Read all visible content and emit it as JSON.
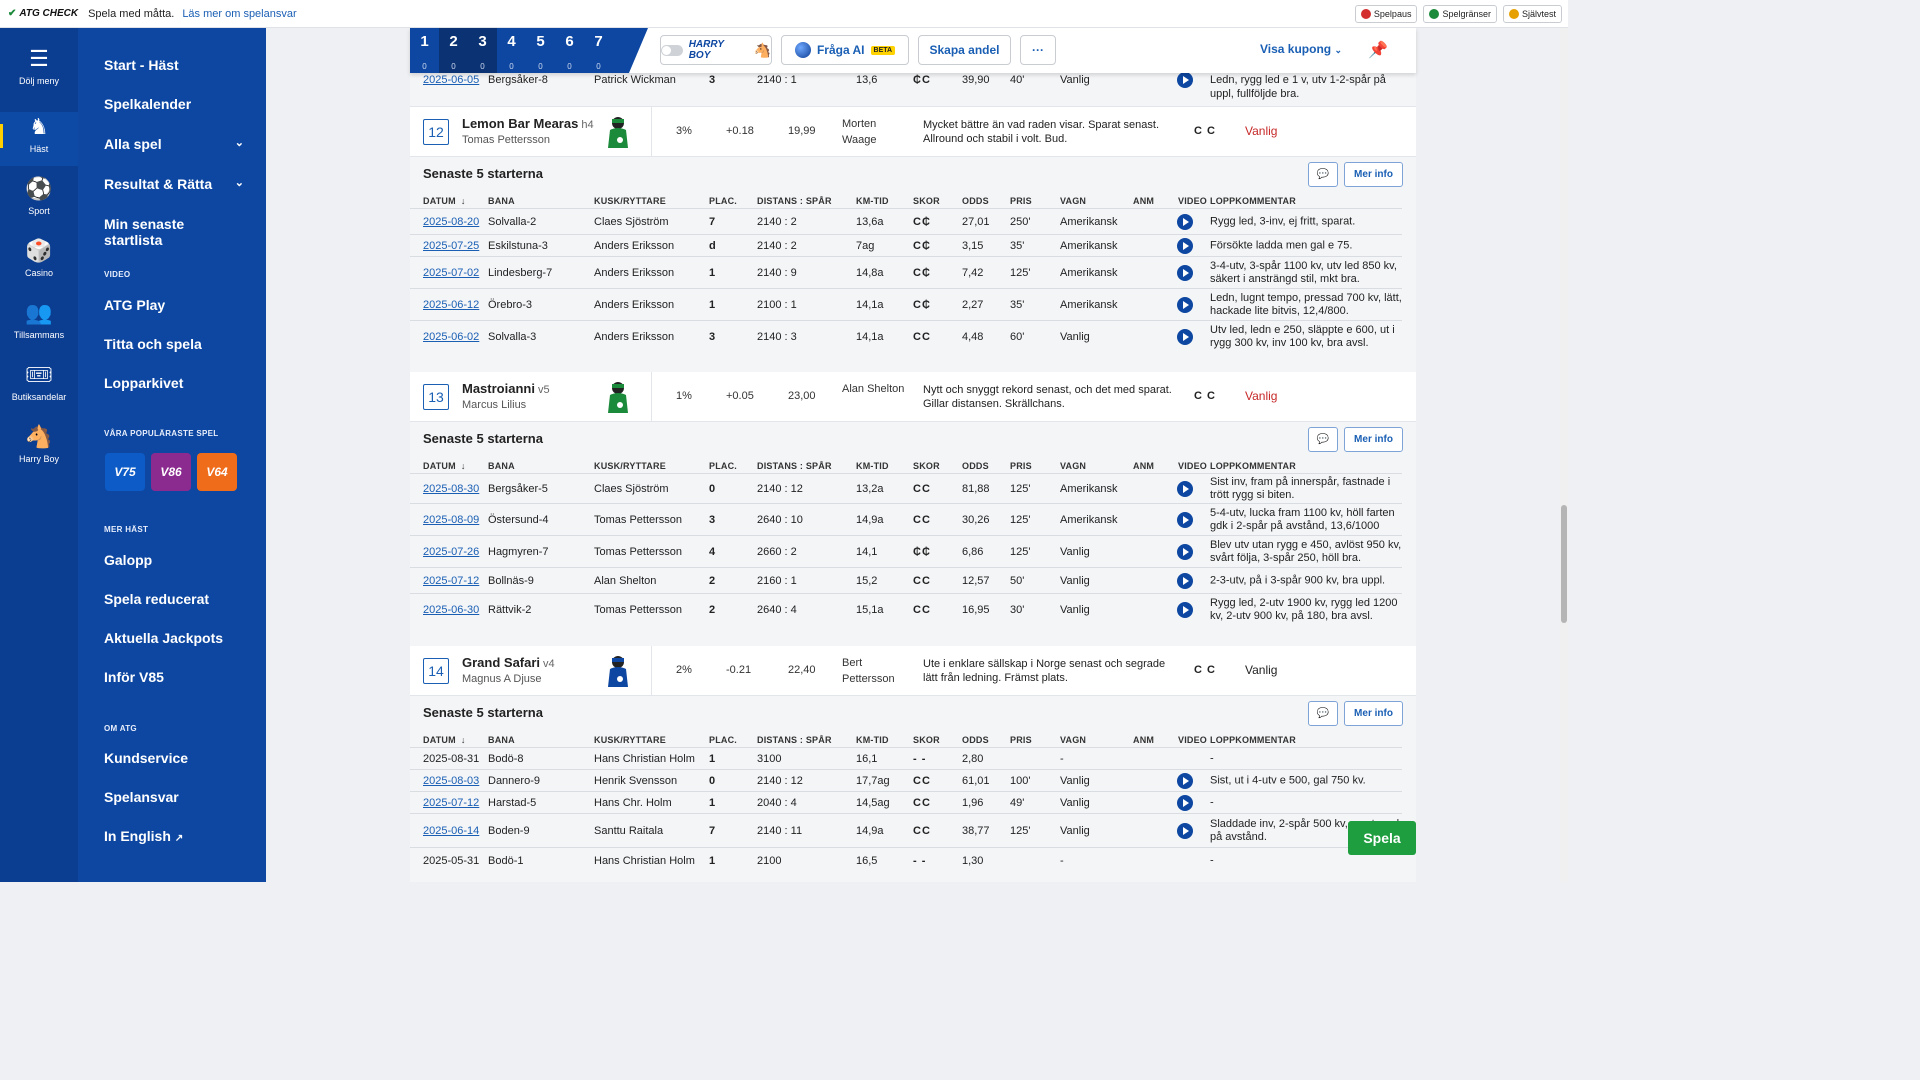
{
  "topbar": {
    "brand": "ATG CHECK",
    "message": "Spela med måtta.",
    "link": "Läs mer om spelansvar",
    "buttons": [
      {
        "label": "Spelpaus",
        "icon": "pause-icon",
        "color": "#d32f2f"
      },
      {
        "label": "Spelgränser",
        "icon": "limit-icon",
        "color": "#1b8a3a"
      },
      {
        "label": "Självtest",
        "icon": "selftest-icon",
        "color": "#e6a100"
      }
    ]
  },
  "rail": [
    {
      "label": "Dölj meny",
      "icon": "menu-icon"
    },
    {
      "label": "Häst",
      "icon": "horse-icon",
      "active": true
    },
    {
      "label": "Sport",
      "icon": "football-icon"
    },
    {
      "label": "Casino",
      "icon": "casino-icon"
    },
    {
      "label": "Tillsammans",
      "icon": "people-icon"
    },
    {
      "label": "Butiksandelar",
      "icon": "coupon-icon"
    },
    {
      "label": "Harry Boy",
      "icon": "harry-boy-icon"
    }
  ],
  "menu": {
    "items": [
      "Start - Häst",
      "Spelkalender",
      "Alla spel",
      "Resultat & Rätta",
      "Min senaste startlista"
    ],
    "video_heading": "VIDEO",
    "video_items": [
      "ATG Play",
      "Titta och spela",
      "Lopparkivet"
    ],
    "popular_heading": "VÅRA POPULÄRASTE SPEL",
    "games": [
      {
        "label": "V75",
        "color": "#0d5bc6"
      },
      {
        "label": "V86",
        "color": "#8b2a8f"
      },
      {
        "label": "V64",
        "color": "#ef6c1a"
      }
    ],
    "more_heading": "MER HÄST",
    "more_items": [
      "Galopp",
      "Spela reducerat",
      "Aktuella Jackpots",
      "Inför V85"
    ],
    "about_heading": "OM ATG",
    "about_items": [
      "Kundservice",
      "Spelansvar",
      "In English"
    ]
  },
  "toolbar": {
    "races": [
      {
        "num": "1",
        "count": "0"
      },
      {
        "num": "2",
        "count": "0",
        "selected": true
      },
      {
        "num": "3",
        "count": "0",
        "selected": true
      },
      {
        "num": "4",
        "count": "0"
      },
      {
        "num": "5",
        "count": "0"
      },
      {
        "num": "6",
        "count": "0"
      },
      {
        "num": "7",
        "count": "0"
      }
    ],
    "harry_boy": "HARRY BOY",
    "ai_label": "Fråga AI",
    "beta": "BETA",
    "andel": "Skapa andel",
    "more": "···",
    "kupong": "Visa kupong"
  },
  "partial_row": [
    "2025-06-05",
    "Bergsåker-8",
    "Patrick Wickman",
    "3",
    "2140 : 1",
    "13,6",
    "₵C",
    "39,90",
    "40'",
    "Vanlig",
    "Ledn, rygg led e 1 v, utv 1-2-spår på",
    "uppl, fullföljde bra."
  ],
  "col_headers": [
    "DATUM",
    "BANA",
    "KUSK/RYTTARE",
    "PLAC.",
    "DISTANS : SPÅR",
    "KM-TID",
    "SKOR",
    "ODDS",
    "PRIS",
    "VAGN",
    "ANM",
    "VIDEO",
    "LOPPKOMMENTAR"
  ],
  "section_title": "Senaste 5 starterna",
  "mer_info": "Mer info",
  "horses": [
    {
      "num": "12",
      "name": "Lemon Bar Mearas",
      "age": "h4",
      "driver": "Tomas Pettersson",
      "jersey_color": "#1b8a3a",
      "pct": "3%",
      "diff": "+0.18",
      "odds": "19,99",
      "trainer": "Morten Waage",
      "comment": "Mycket bättre än vad raden visar. Sparat senast. Allround och stabil i volt. Bud.",
      "shoes": "C C",
      "vagn": "Vanlig",
      "vagn_color": "#c62828",
      "starts": [
        {
          "date": "2025-08-20",
          "track": "Solvalla-2",
          "driver": "Claes Sjöström",
          "plac": "7",
          "dist": "2140 : 2",
          "km": "13,6a",
          "shoe": "C₵",
          "odds": "27,01",
          "pris": "250'",
          "vagn": "Amerikansk",
          "video": true,
          "com": "Rygg led, 3-inv, ej fritt, sparat."
        },
        {
          "date": "2025-07-25",
          "track": "Eskilstuna-3",
          "driver": "Anders Eriksson",
          "plac": "d",
          "dist": "2140 : 2",
          "km": "7ag",
          "shoe": "C₵",
          "odds": "3,15",
          "pris": "35'",
          "vagn": "Amerikansk",
          "video": true,
          "com": "Försökte ladda men gal e 75."
        },
        {
          "date": "2025-07-02",
          "track": "Lindesberg-7",
          "driver": "Anders Eriksson",
          "plac": "1",
          "dist": "2140 : 9",
          "km": "14,8a",
          "shoe": "C₵",
          "odds": "7,42",
          "pris": "125'",
          "vagn": "Amerikansk",
          "video": true,
          "com": "3-4-utv, 3-spår 1100 kv, utv led 850 kv, säkert i ansträngd stil, mkt bra."
        },
        {
          "date": "2025-06-12",
          "track": "Örebro-3",
          "driver": "Anders Eriksson",
          "plac": "1",
          "dist": "2100 : 1",
          "km": "14,1a",
          "shoe": "C₵",
          "odds": "2,27",
          "pris": "35'",
          "vagn": "Amerikansk",
          "video": true,
          "com": "Ledn, lugnt tempo, pressad 700 kv, lätt, hackade lite bitvis, 12,4/800."
        },
        {
          "date": "2025-06-02",
          "track": "Solvalla-3",
          "driver": "Anders Eriksson",
          "plac": "3",
          "dist": "2140 : 3",
          "km": "14,1a",
          "shoe": "CC",
          "odds": "4,48",
          "pris": "60'",
          "vagn": "Vanlig",
          "video": true,
          "com": "Utv led, ledn e 250, släppte e 600, ut i rygg 300 kv, inv 100 kv, bra avsl."
        }
      ]
    },
    {
      "num": "13",
      "name": "Mastroianni",
      "age": "v5",
      "driver": "Marcus Lilius",
      "jersey_color": "#1b8a3a",
      "pct": "1%",
      "diff": "+0.05",
      "odds": "23,00",
      "trainer": "Alan Shelton",
      "comment": "Nytt och snyggt rekord senast, och det med sparat. Gillar distansen. Skrällchans.",
      "shoes": "C C",
      "vagn": "Vanlig",
      "vagn_color": "#c62828",
      "starts": [
        {
          "date": "2025-08-30",
          "track": "Bergsåker-5",
          "driver": "Claes Sjöström",
          "plac": "0",
          "dist": "2140 : 12",
          "km": "13,2a",
          "shoe": "CC",
          "odds": "81,88",
          "pris": "125'",
          "vagn": "Amerikansk",
          "video": true,
          "com": "Sist inv, fram på innerspår, fastnade i trött rygg si biten."
        },
        {
          "date": "2025-08-09",
          "track": "Östersund-4",
          "driver": "Tomas Pettersson",
          "plac": "3",
          "dist": "2640 : 10",
          "km": "14,9a",
          "shoe": "CC",
          "odds": "30,26",
          "pris": "125'",
          "vagn": "Amerikansk",
          "video": true,
          "com": "5-4-utv, lucka fram 1100 kv, höll farten gdk i 2-spår på avstånd, 13,6/1000"
        },
        {
          "date": "2025-07-26",
          "track": "Hagmyren-7",
          "driver": "Tomas Pettersson",
          "plac": "4",
          "dist": "2660 : 2",
          "km": "14,1",
          "shoe": "₵₵",
          "odds": "6,86",
          "pris": "125'",
          "vagn": "Vanlig",
          "video": true,
          "com": "Blev utv utan rygg e 450, avlöst 950 kv, svårt följa, 3-spår 250, höll bra."
        },
        {
          "date": "2025-07-12",
          "track": "Bollnäs-9",
          "driver": "Alan Shelton",
          "plac": "2",
          "dist": "2160 : 1",
          "km": "15,2",
          "shoe": "CC",
          "odds": "12,57",
          "pris": "50'",
          "vagn": "Vanlig",
          "video": true,
          "com": "2-3-utv, på i 3-spår 900 kv, bra uppl."
        },
        {
          "date": "2025-06-30",
          "track": "Rättvik-2",
          "driver": "Tomas Pettersson",
          "plac": "2",
          "dist": "2640 : 4",
          "km": "15,1a",
          "shoe": "CC",
          "odds": "16,95",
          "pris": "30'",
          "vagn": "Vanlig",
          "video": true,
          "com": "Rygg led, 2-utv 1900 kv, rygg led 1200 kv, 2-utv 900 kv, på 180, bra avsl."
        }
      ]
    },
    {
      "num": "14",
      "name": "Grand Safari",
      "age": "v4",
      "driver": "Magnus A Djuse",
      "jersey_color": "#0d47a1",
      "pct": "2%",
      "diff": "-0.21",
      "odds": "22,40",
      "trainer": "Bert Pettersson",
      "comment": "Ute i enklare sällskap i Norge senast och segrade lätt från ledning. Främst plats.",
      "shoes": "C C",
      "vagn": "Vanlig",
      "vagn_color": "#222222",
      "starts": [
        {
          "date": "2025-08-31",
          "track": "Bodö-8",
          "driver": "Hans Christian Holm",
          "plac": "1",
          "dist": "3100",
          "km": "16,1",
          "shoe": "- -",
          "odds": "2,80",
          "pris": "",
          "vagn": "-",
          "video": false,
          "com": "-",
          "plain": true
        },
        {
          "date": "2025-08-03",
          "track": "Dannero-9",
          "driver": "Henrik Svensson",
          "plac": "0",
          "dist": "2140 : 12",
          "km": "17,7ag",
          "shoe": "CC",
          "odds": "61,01",
          "pris": "100'",
          "vagn": "Vanlig",
          "video": true,
          "com": "Sist, ut i 4-utv e 500, gal 750 kv."
        },
        {
          "date": "2025-07-12",
          "track": "Harstad-5",
          "driver": "Hans Chr. Holm",
          "plac": "1",
          "dist": "2040 : 4",
          "km": "14,5ag",
          "shoe": "CC",
          "odds": "1,96",
          "pris": "49'",
          "vagn": "Vanlig",
          "video": true,
          "com": "-"
        },
        {
          "date": "2025-06-14",
          "track": "Boden-9",
          "driver": "Santtu Raitala",
          "plac": "7",
          "dist": "2140 : 11",
          "km": "14,9a",
          "shoe": "CC",
          "odds": "38,77",
          "pris": "125'",
          "vagn": "Vanlig",
          "video": true,
          "com": "Sladdade inv, 2-spår 500 kv, mest med på avstånd."
        },
        {
          "date": "2025-05-31",
          "track": "Bodö-1",
          "driver": "Hans Christian Holm",
          "plac": "1",
          "dist": "2100",
          "km": "16,5",
          "shoe": "- -",
          "odds": "1,30",
          "pris": "",
          "vagn": "-",
          "video": false,
          "com": "-",
          "plain": true
        }
      ]
    }
  ],
  "spela_button": "Spela"
}
